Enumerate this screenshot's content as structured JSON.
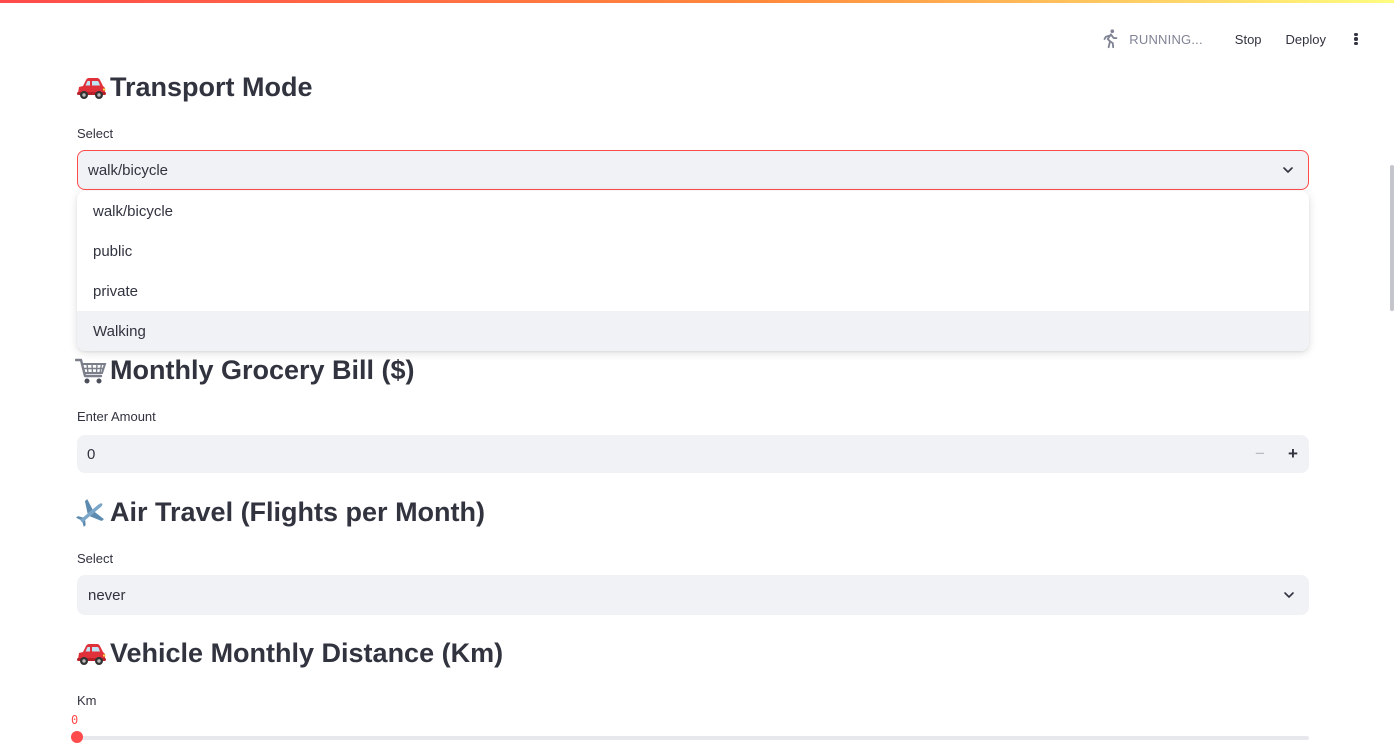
{
  "header": {
    "status_label": "RUNNING...",
    "stop_label": "Stop",
    "deploy_label": "Deploy"
  },
  "transport": {
    "title": "Transport Mode",
    "label": "Select",
    "value": "walk/bicycle",
    "options": [
      "walk/bicycle",
      "public",
      "private",
      "Walking"
    ]
  },
  "grocery": {
    "title": "Monthly Grocery Bill ($)",
    "label": "Enter Amount",
    "value": "0",
    "minus": "−",
    "plus": "+"
  },
  "air": {
    "title": "Air Travel (Flights per Month)",
    "label": "Select",
    "value": "never"
  },
  "vehicle": {
    "title": "Vehicle Monthly Distance (Km)",
    "label": "Km",
    "value": "0"
  },
  "colors": {
    "accent": "#ff4b4b",
    "text": "#31333f",
    "input_bg": "#f0f2f6",
    "muted": "#808495"
  },
  "icons": [
    "running-man-icon",
    "more-vert-icon",
    "car-icon",
    "shopping-cart-icon",
    "airplane-icon",
    "chevron-down-icon"
  ]
}
